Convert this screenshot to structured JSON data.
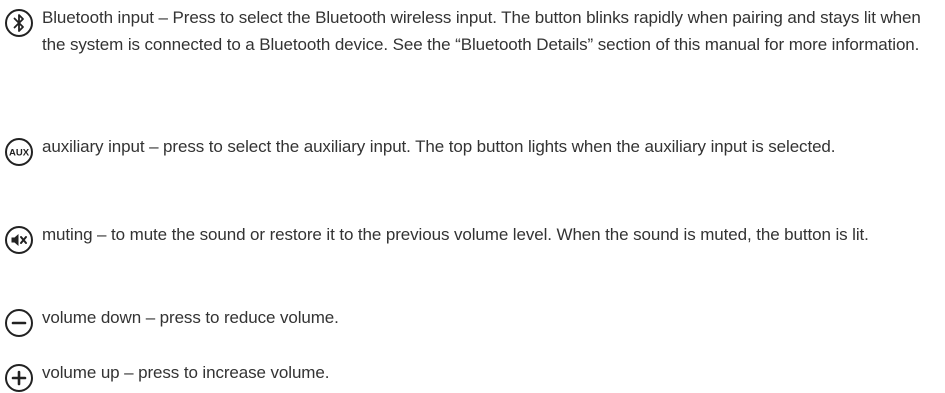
{
  "controls": [
    {
      "icon": "bluetooth-icon",
      "description": "Bluetooth input – Press to select the Bluetooth wireless input. The button blinks rapidly when pairing and stays lit when the system is connected to a Bluetooth device. See the “Bluetooth Details” section of this manual for more information."
    },
    {
      "icon": "aux-icon",
      "icon_text": "AUX",
      "description": "auxiliary input – press to select the auxiliary input. The top button lights when the auxiliary input is selected."
    },
    {
      "icon": "mute-icon",
      "description": "muting – to mute the sound or restore it to the previous volume level. When the sound is muted, the button is lit."
    },
    {
      "icon": "minus-icon",
      "description": "volume down – press to reduce volume."
    },
    {
      "icon": "plus-icon",
      "description": "volume up – press to increase volume."
    }
  ],
  "colors": {
    "text": "#333333",
    "icon": "#222222"
  }
}
